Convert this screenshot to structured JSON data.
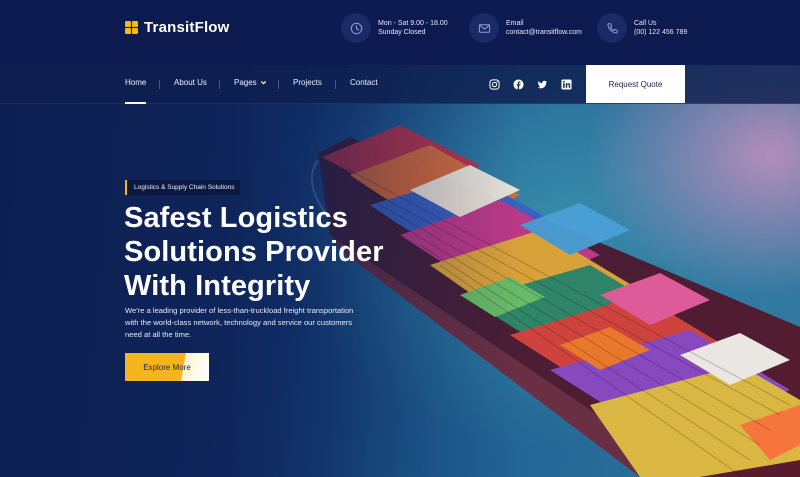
{
  "brand": {
    "name": "TransitFlow"
  },
  "contact": {
    "hours": {
      "line1": "Mon - Sat 9.00 - 18.00",
      "line2": "Sunday Closed",
      "icon": "clock-icon"
    },
    "email": {
      "line1": "Email",
      "line2": "contact@transitflow.com",
      "icon": "mail-icon"
    },
    "phone": {
      "line1": "Call Us",
      "line2": "(00) 122 456 789",
      "icon": "phone-icon"
    }
  },
  "nav": {
    "items": [
      {
        "label": "Home",
        "active": true
      },
      {
        "label": "About Us"
      },
      {
        "label": "Pages"
      },
      {
        "label": "Projects"
      },
      {
        "label": "Contact"
      }
    ],
    "social": [
      "instagram-icon",
      "facebook-icon",
      "twitter-icon",
      "linkedin-icon"
    ],
    "cta": "Request Quote"
  },
  "hero": {
    "tag": "Logistics & Supply Chain Solutions",
    "headline": [
      "Safest Logistics",
      "Solutions Provider",
      "With Integrity"
    ],
    "description": [
      "We're a leading provider of less-than-truckload freight transportation",
      "with the world-class network, technology and service our customers",
      "need at all the time."
    ],
    "button": "Explore More"
  },
  "colors": {
    "accent": "#f5b820",
    "navy": "#0d1a4f",
    "white": "#ffffff"
  }
}
